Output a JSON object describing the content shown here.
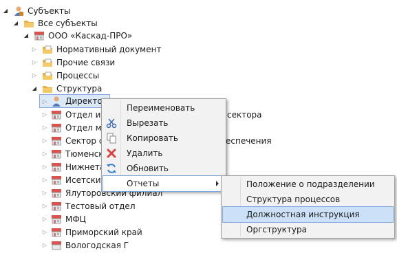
{
  "tree": {
    "items": [
      {
        "label": "Субъекты",
        "icon": "user-group-icon",
        "expanded": true
      },
      {
        "label": "Все субъекты",
        "icon": "folder-icon",
        "expanded": true
      },
      {
        "label": "ООО «Каскад-ПРО»",
        "icon": "building-icon",
        "expanded": true
      },
      {
        "label": "Нормативный документ",
        "icon": "folder-doc-icon",
        "expanded": false
      },
      {
        "label": "Прочие связи",
        "icon": "folder-doc-icon",
        "expanded": false
      },
      {
        "label": "Процессы",
        "icon": "folder-doc-icon",
        "expanded": false
      },
      {
        "label": "Структура",
        "icon": "folder-icon",
        "expanded": true
      },
      {
        "label": "Директор",
        "icon": "person-icon",
        "expanded": false,
        "selected": true
      },
      {
        "label": "Отдел инс",
        "icon": "building-icon",
        "expanded": false
      },
      {
        "label": "Отдел мет",
        "icon": "building-icon",
        "expanded": false
      },
      {
        "label": "Сектор со",
        "icon": "building-icon",
        "expanded": false
      },
      {
        "label": "Тюменски",
        "icon": "building-icon",
        "expanded": false
      },
      {
        "label": "Нижнетав",
        "icon": "building-icon",
        "expanded": false
      },
      {
        "label": "Исетский",
        "icon": "building-icon",
        "expanded": false
      },
      {
        "label": "Ялуторовский филиал",
        "icon": "building-icon",
        "expanded": false
      },
      {
        "label": "Тестовый отдел",
        "icon": "building-icon",
        "expanded": false
      },
      {
        "label": "МФЦ",
        "icon": "building-icon",
        "expanded": false
      },
      {
        "label": "Приморский край",
        "icon": "building-icon",
        "expanded": false
      },
      {
        "label": "Вологодская Г",
        "icon": "building-icon",
        "expanded": false
      }
    ],
    "behind_text": {
      "row8": "сектора",
      "row10": "еспечения"
    }
  },
  "context_menu": {
    "items": [
      {
        "label": "Переименовать",
        "icon": ""
      },
      {
        "label": "Вырезать",
        "icon": "scissors-icon"
      },
      {
        "label": "Копировать",
        "icon": "copy-icon"
      },
      {
        "label": "Удалить",
        "icon": "delete-x-icon"
      },
      {
        "label": "Обновить",
        "icon": "refresh-icon"
      },
      {
        "label": "Отчеты",
        "icon": "",
        "submenu": true
      }
    ]
  },
  "submenu": {
    "items": [
      {
        "label": "Положение о подразделении"
      },
      {
        "label": "Структура процессов"
      },
      {
        "label": "Должностная инструкция",
        "highlighted": true
      },
      {
        "label": "Оргструктура"
      }
    ]
  },
  "colors": {
    "selection": "#dbe9f9",
    "selection_border": "#84acdd",
    "menu_bg": "#f2f2f2",
    "menu_highlight": "#cce0f7",
    "building_red": "#d9534f",
    "folder_yellow": "#e8b04a"
  }
}
